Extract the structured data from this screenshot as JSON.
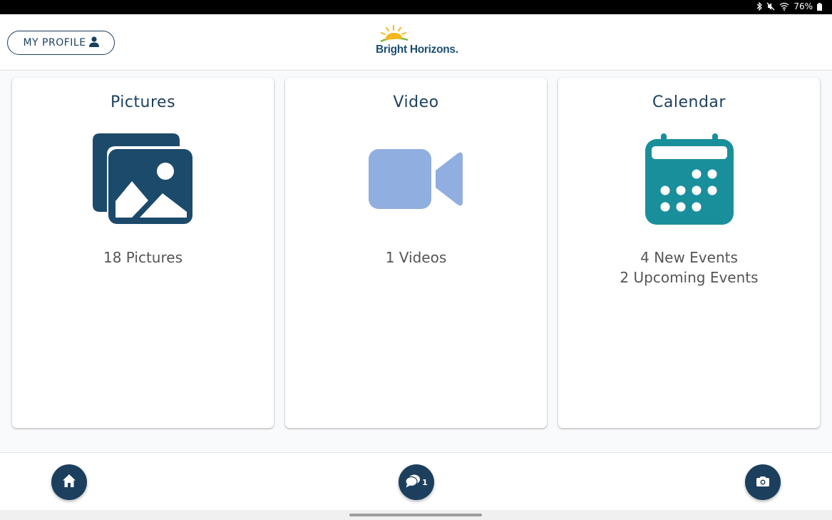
{
  "status_bar": {
    "battery": "76%",
    "icons": [
      "bluetooth-icon",
      "mute-icon",
      "wifi-icon",
      "battery-icon"
    ]
  },
  "header": {
    "profile_button": "MY PROFILE",
    "profile_icon": "person-icon",
    "logo_text": "Bright Horizons."
  },
  "cards": [
    {
      "title": "Pictures",
      "icon": "pictures-icon",
      "lines": [
        "18 Pictures"
      ]
    },
    {
      "title": "Video",
      "icon": "video-camera-icon",
      "lines": [
        "1 Videos"
      ]
    },
    {
      "title": "Calendar",
      "icon": "calendar-icon",
      "lines": [
        "4 New Events",
        "2 Upcoming Events"
      ]
    }
  ],
  "bottom_bar": {
    "home_icon": "home-icon",
    "chat_icon": "chat-icon",
    "chat_count": "1",
    "camera_icon": "camera-icon"
  },
  "colors": {
    "navy": "#1c3f5e",
    "pictures_icon": "#1c4a6b",
    "video_icon": "#91aee0",
    "calendar_icon": "#1a8f9c"
  }
}
